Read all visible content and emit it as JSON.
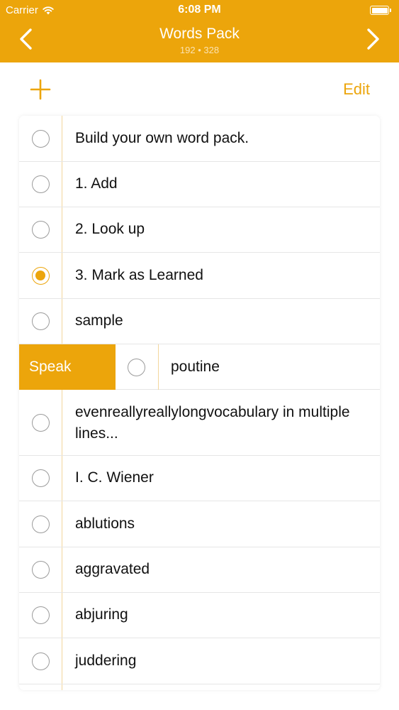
{
  "status_bar": {
    "carrier": "Carrier",
    "time": "6:08 PM"
  },
  "nav": {
    "title": "Words Pack",
    "subtitle": "192 • 328",
    "back_icon": "chevron-left-icon",
    "forward_icon": "chevron-right-icon"
  },
  "toolbar": {
    "add_icon": "plus-icon",
    "edit_label": "Edit"
  },
  "colors": {
    "accent": "#eca50b",
    "separator": "#e6e6e6",
    "radio_border": "#9b9b9b"
  },
  "list": {
    "items": [
      {
        "label": "Build your own word pack.",
        "learned": false
      },
      {
        "label": "1. Add",
        "learned": false
      },
      {
        "label": "2. Look up",
        "learned": false
      },
      {
        "label": "3. Mark as Learned",
        "learned": true
      },
      {
        "label": "sample",
        "learned": false
      },
      {
        "label": "poutine",
        "learned": false,
        "swiped": true,
        "action_label": "Speak"
      },
      {
        "label": "evenreallyreallylongvocabulary in multiple lines...",
        "learned": false
      },
      {
        "label": "I. C. Wiener",
        "learned": false
      },
      {
        "label": "ablutions",
        "learned": false
      },
      {
        "label": "aggravated",
        "learned": false
      },
      {
        "label": "abjuring",
        "learned": false
      },
      {
        "label": "juddering",
        "learned": false
      }
    ]
  }
}
